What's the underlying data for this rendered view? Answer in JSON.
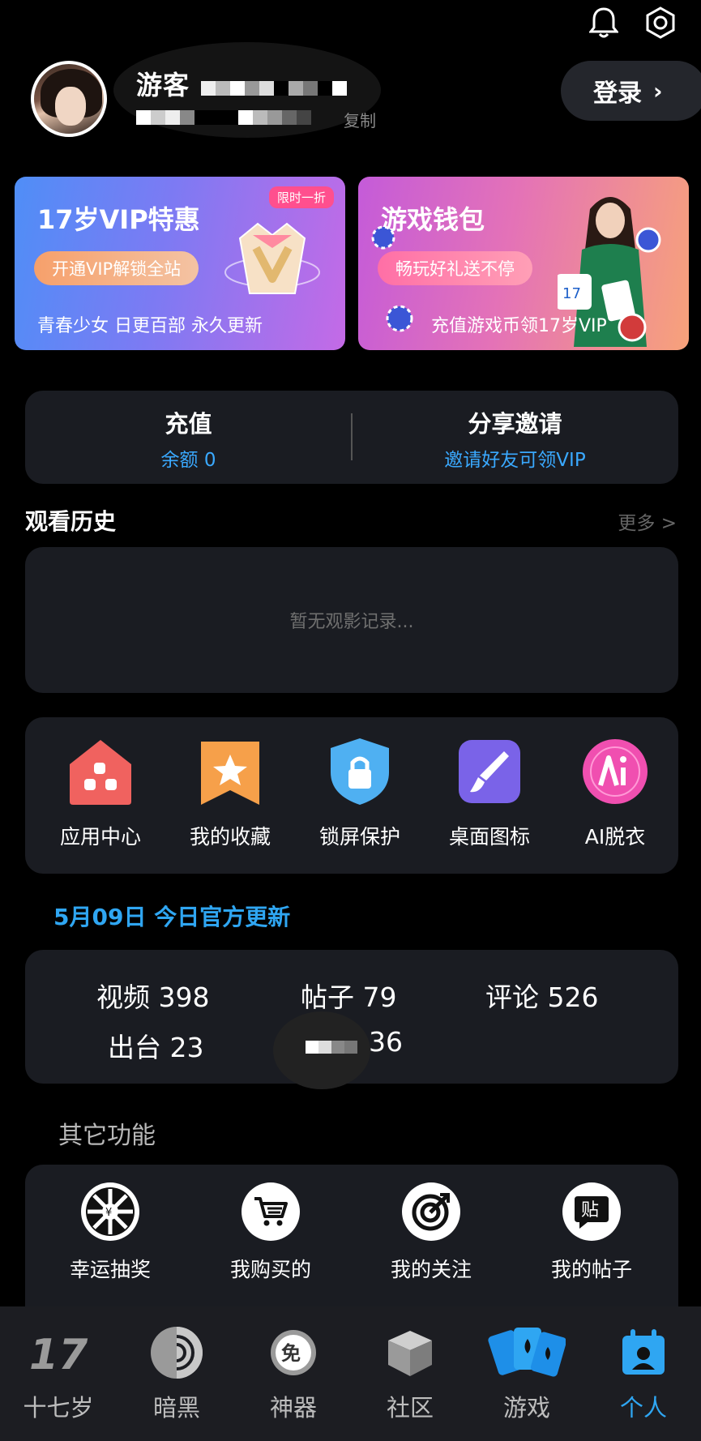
{
  "header": {
    "bell_icon": "bell-icon",
    "settings_icon": "gear-hex-icon"
  },
  "profile": {
    "username": "游客",
    "copy_label": "复制",
    "login_label": "登录"
  },
  "banners": {
    "vip": {
      "title": "17岁VIP特惠",
      "tag": "限时一折",
      "pill": "开通VIP解锁全站",
      "bottom": "青春少女   日更百部   永久更新"
    },
    "wallet": {
      "title": "游戏钱包",
      "pill": "畅玩好礼送不停",
      "bottom": "充值游戏币领17岁VIP"
    }
  },
  "account": {
    "recharge_title": "充值",
    "recharge_sub": "余额 0",
    "invite_title": "分享邀请",
    "invite_sub": "邀请好友可领VIP"
  },
  "history": {
    "title": "观看历史",
    "more": "更多 >",
    "empty": "暂无观影记录..."
  },
  "apps": [
    {
      "label": "应用中心",
      "icon": "app-center-icon",
      "color": "#f0625f"
    },
    {
      "label": "我的收藏",
      "icon": "star-bookmark-icon",
      "color": "#f6a04a"
    },
    {
      "label": "锁屏保护",
      "icon": "lock-shield-icon",
      "color": "#4fb0f2"
    },
    {
      "label": "桌面图标",
      "icon": "brush-icon",
      "color": "#7a63e8"
    },
    {
      "label": "AI脱衣",
      "icon": "ai-icon",
      "color": "#f04fb0"
    }
  ],
  "update": {
    "title": "5月09日 今日官方更新",
    "stats": [
      {
        "label": "视频",
        "value": "398"
      },
      {
        "label": "帖子",
        "value": "79"
      },
      {
        "label": "评论",
        "value": "526"
      },
      {
        "label": "出台",
        "value": "23"
      },
      {
        "label": "",
        "value": "36"
      }
    ]
  },
  "other": {
    "title": "其它功能",
    "items": [
      {
        "label": "幸运抽奖",
        "icon": "lucky-wheel-icon"
      },
      {
        "label": "我购买的",
        "icon": "cart-icon"
      },
      {
        "label": "我的关注",
        "icon": "target-icon"
      },
      {
        "label": "我的帖子",
        "icon": "post-icon"
      }
    ]
  },
  "nav": [
    {
      "label": "十七岁",
      "icon": "seventeen-logo-icon"
    },
    {
      "label": "暗黑",
      "icon": "dark-circle-icon"
    },
    {
      "label": "神器",
      "icon": "free-badge-icon"
    },
    {
      "label": "社区",
      "icon": "cube-icon"
    },
    {
      "label": "游戏",
      "icon": "cards-icon"
    },
    {
      "label": "个人",
      "icon": "profile-calendar-icon",
      "active": true
    }
  ],
  "colors": {
    "accent": "#2fa6f2",
    "card_bg": "#1a1c22"
  }
}
